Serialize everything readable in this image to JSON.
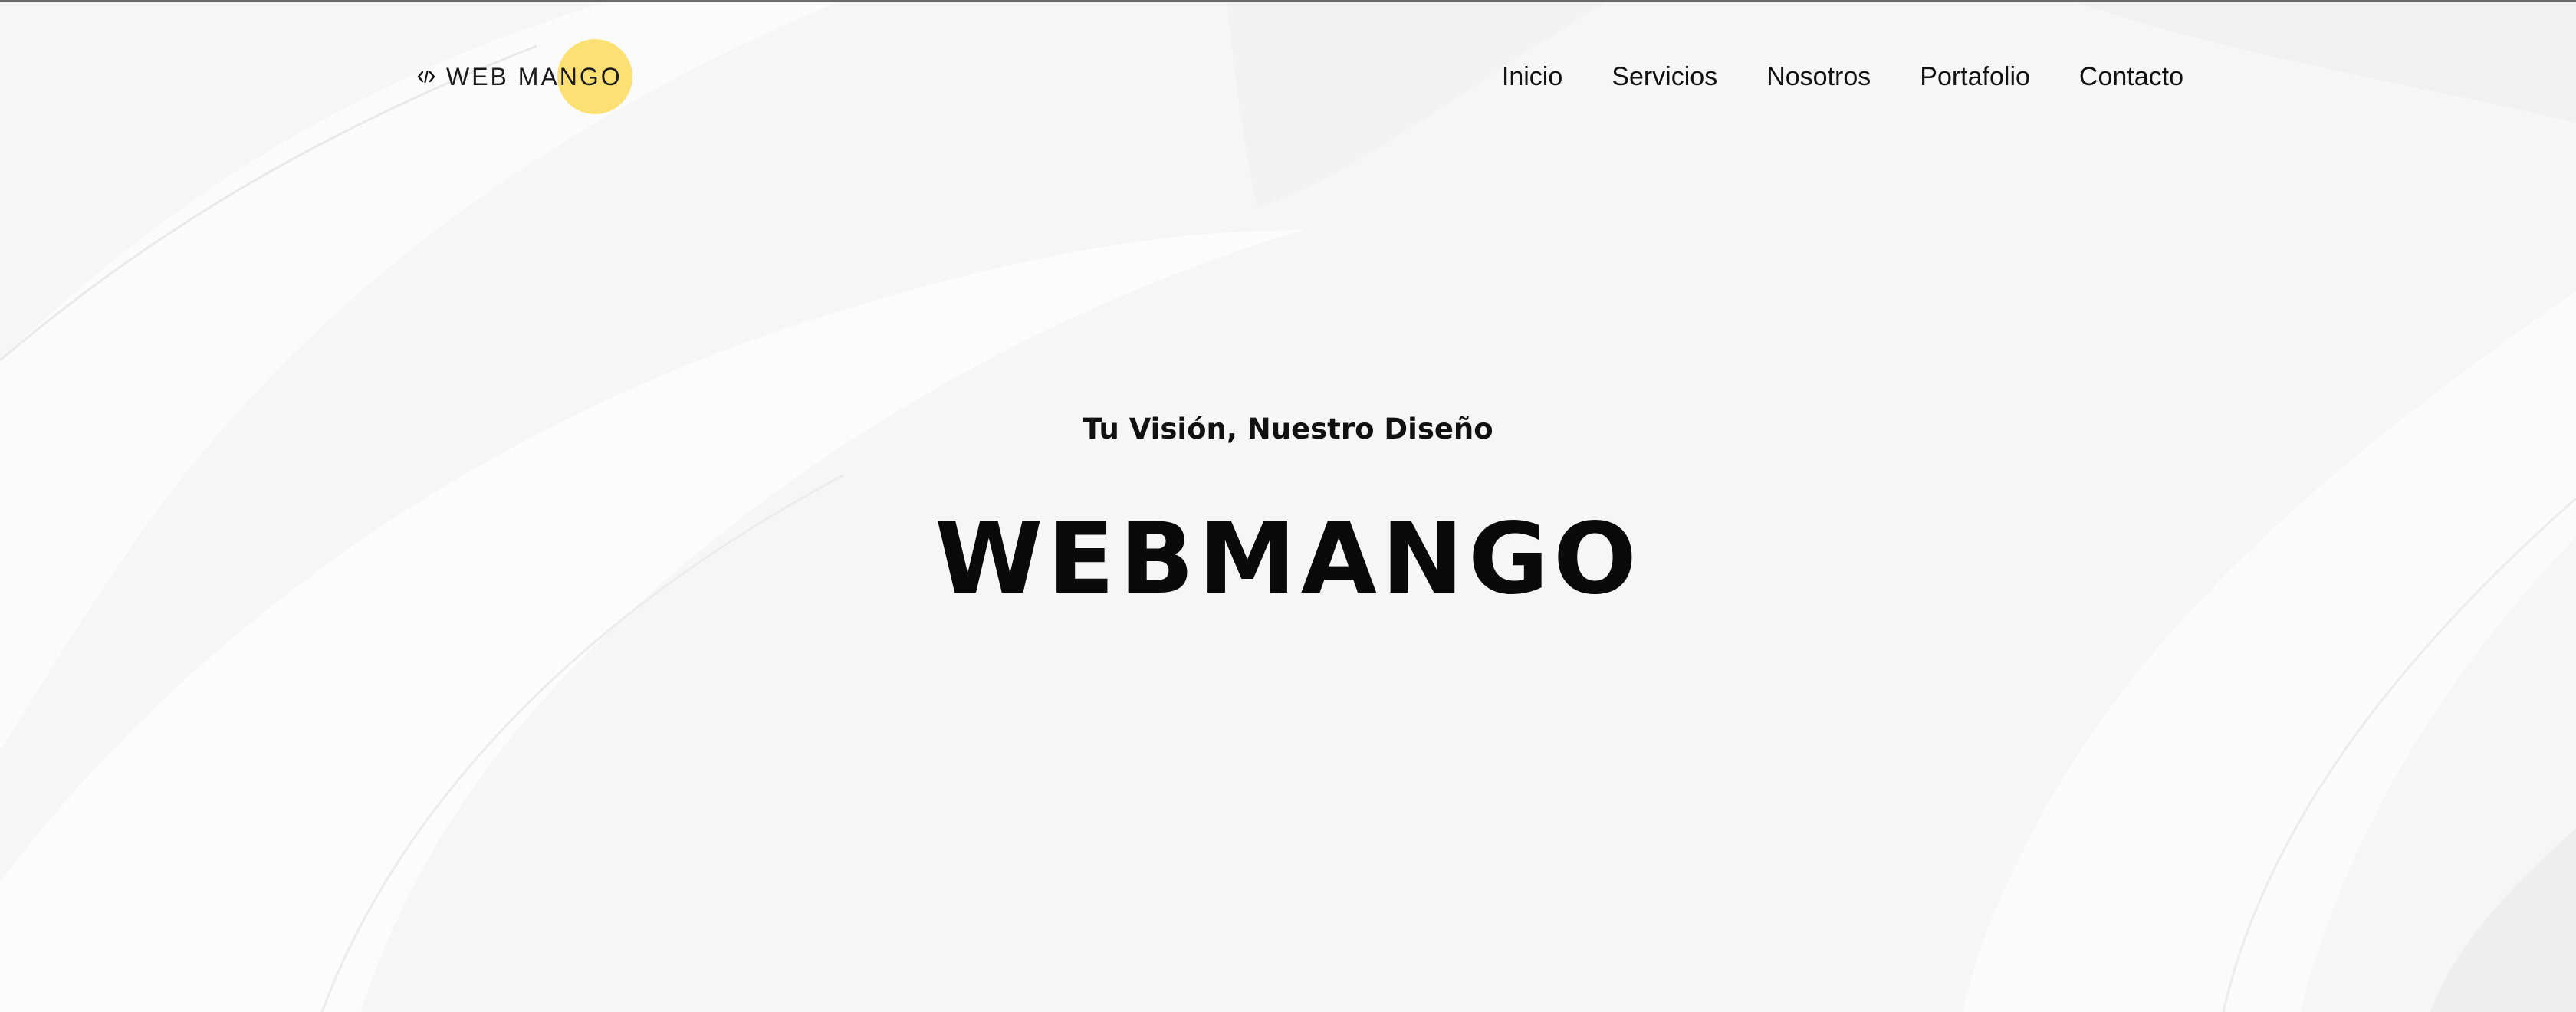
{
  "brand": {
    "name": "WEB MANGO",
    "icon": "code-icon",
    "accent_color": "#fde073"
  },
  "nav": {
    "items": [
      {
        "label": "Inicio"
      },
      {
        "label": "Servicios"
      },
      {
        "label": "Nosotros"
      },
      {
        "label": "Portafolio"
      },
      {
        "label": "Contacto"
      }
    ]
  },
  "hero": {
    "tagline": "Tu Visión, Nuestro Diseño",
    "title": "WEBMANGO"
  },
  "colors": {
    "background": "#f7f7f7",
    "text": "#0a0a0a"
  }
}
